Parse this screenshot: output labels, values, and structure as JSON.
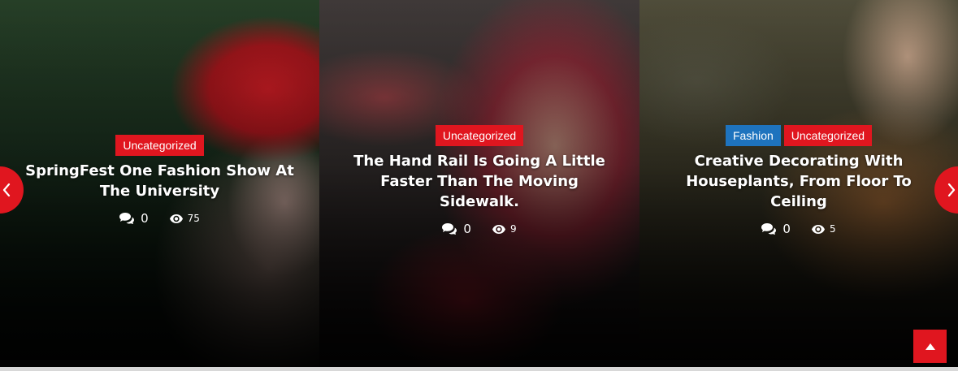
{
  "slides": [
    {
      "categories": [
        {
          "label": "Uncategorized",
          "color": "#e0161f"
        }
      ],
      "title": "SpringFest One Fashion Show At The University",
      "comments": "0",
      "views": "75"
    },
    {
      "categories": [
        {
          "label": "Uncategorized",
          "color": "#e0161f"
        }
      ],
      "title": "The Hand Rail Is Going A Little Faster Than The Moving Sidewalk.",
      "comments": "0",
      "views": "9"
    },
    {
      "categories": [
        {
          "label": "Fashion",
          "color": "#1e73be"
        },
        {
          "label": "Uncategorized",
          "color": "#e0161f"
        }
      ],
      "title": "Creative Decorating With Houseplants, From Floor To Ceiling",
      "comments": "0",
      "views": "5"
    }
  ],
  "icons": {
    "comment": "comments-icon",
    "views": "eye-icon",
    "prev": "chevron-left-icon",
    "next": "chevron-right-icon",
    "totop": "arrow-up-icon"
  },
  "colors": {
    "accent": "#e0161f",
    "fashion": "#1e73be"
  }
}
